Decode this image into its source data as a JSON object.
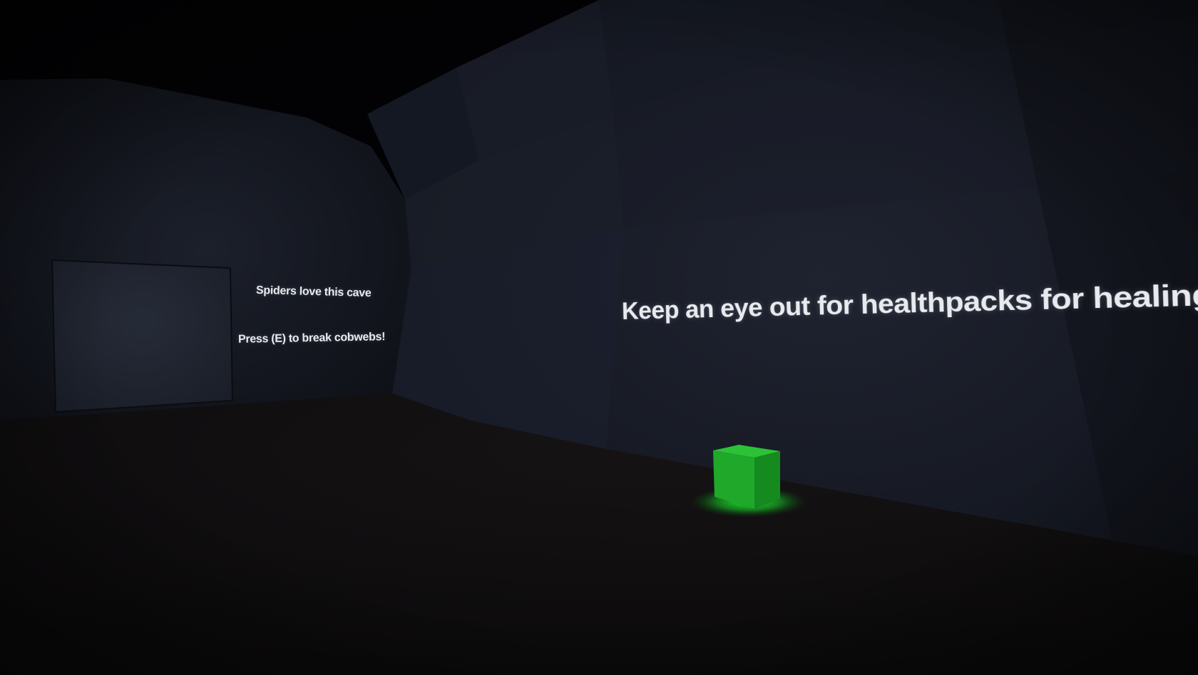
{
  "scene": {
    "signs": {
      "spiders": "Spiders love this cave",
      "cobwebs": "Press (E) to break cobwebs!",
      "healthpacks": "Keep an eye out for healthpacks for healing!"
    },
    "pickup": {
      "icon": "healthpack-cube-icon",
      "color": "#1fa82a",
      "glow_color": "#19ff2a"
    },
    "colors": {
      "wall": "#1a1e28",
      "floor": "#0f0d0e",
      "sky": "#000000",
      "text": "#e8eaee"
    }
  }
}
